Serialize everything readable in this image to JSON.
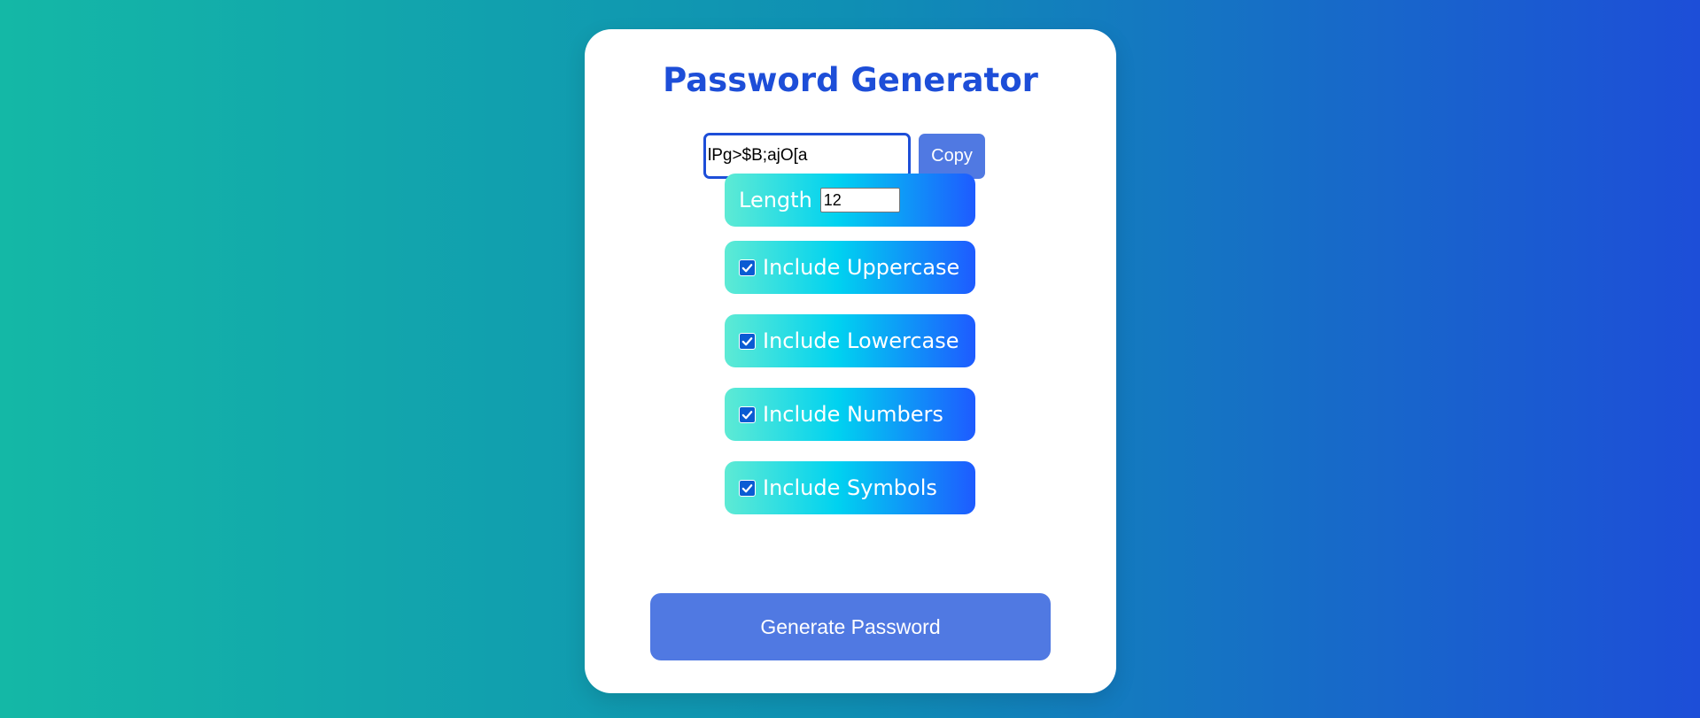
{
  "app": {
    "title": "Password Generator"
  },
  "password": {
    "value": "lPg>$B;ajO[a",
    "copy_label": "Copy"
  },
  "options": {
    "length": {
      "label": "Length",
      "value": "12"
    },
    "uppercase": {
      "label": "Include Uppercase",
      "checked": true
    },
    "lowercase": {
      "label": "Include Lowercase",
      "checked": true
    },
    "numbers": {
      "label": "Include Numbers",
      "checked": true
    },
    "symbols": {
      "label": "Include Symbols",
      "checked": true
    }
  },
  "generate_label": "Generate Password",
  "colors": {
    "accent": "#1d4ed8",
    "button": "#5079e2",
    "background_start": "#14b8a6",
    "background_end": "#1d4ed8"
  },
  "icons": {
    "checkbox": "check-icon"
  }
}
